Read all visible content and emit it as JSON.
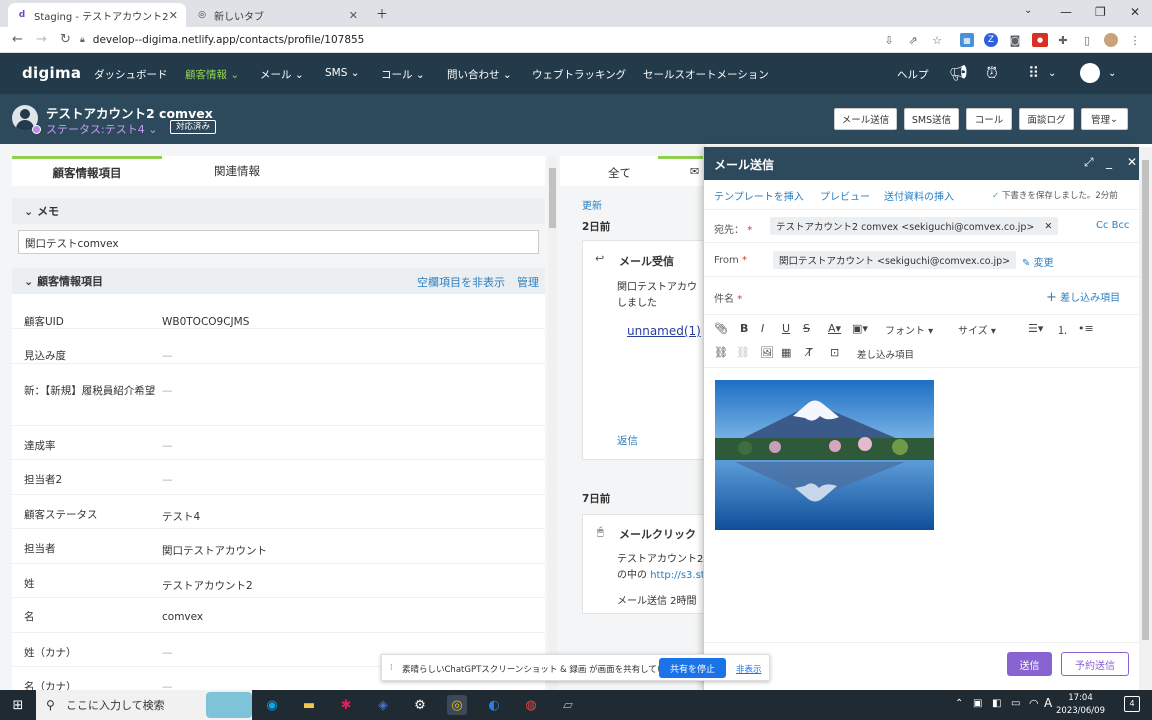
{
  "browser": {
    "tabs": [
      {
        "title": "Staging - テストアカウント2 comvex",
        "active": true
      },
      {
        "title": "新しいタブ",
        "active": false
      }
    ],
    "url": "develop--digima.netlify.app/contacts/profile/107855"
  },
  "app": {
    "logo": "digima",
    "nav": [
      "ダッシュボード",
      "顧客情報",
      "メール",
      "SMS",
      "コール",
      "問い合わせ",
      "ウェブトラッキング",
      "セールスオートメーション"
    ],
    "selected_nav": "顧客情報",
    "help": "ヘルプ"
  },
  "contact": {
    "name": "テストアカウント2 comvex",
    "status": "ステータス:テスト4",
    "badge": "対応済み",
    "actions": [
      "メール送信",
      "SMS送信",
      "コール",
      "面談ログ",
      "管理"
    ]
  },
  "left": {
    "tabs": [
      "顧客情報項目",
      "関連情報"
    ],
    "memo_title": "メモ",
    "memo_value": "関口テストcomvex",
    "info_title": "顧客情報項目",
    "hide_empty": "空欄項目を非表示",
    "manage": "管理",
    "rows": [
      {
        "label": "顧客UID",
        "value": "WB0TOCO9CJMS"
      },
      {
        "label": "見込み度",
        "value": "—"
      },
      {
        "label": "新：【新規】履税員紹介希望",
        "value": "—"
      },
      {
        "label": "達成率",
        "value": "—"
      },
      {
        "label": "担当者2",
        "value": "—"
      },
      {
        "label": "顧客ステータス",
        "value": "テスト4"
      },
      {
        "label": "担当者",
        "value": "関口テストアカウント"
      },
      {
        "label": "姓",
        "value": "テストアカウント2"
      },
      {
        "label": "名",
        "value": "comvex"
      },
      {
        "label": "姓（カナ）",
        "value": "—"
      },
      {
        "label": "名（カナ）",
        "value": "—"
      }
    ]
  },
  "timeline": {
    "tab_all": "全て",
    "update": "更新",
    "group1": "2日前",
    "card1_title": "メール受信",
    "card1_text1": "関口テストアカウ",
    "card1_text2": "しました",
    "card1_link": "unnamed(1)",
    "card1_reply": "返信",
    "group2": "7日前",
    "card2_title": "メールクリック",
    "card2_text1": "テストアカウント2",
    "card2_text2": "の中の",
    "card2_link": "http://s3.sta",
    "card2_footer": "メール送信 2時間"
  },
  "email": {
    "title": "メール送信",
    "insert_template": "テンプレートを挿入",
    "preview": "プレビュー",
    "attach": "送付資料の挿入",
    "saved": "下書きを保存しました。2分前",
    "to_label": "宛先：",
    "to_value": "テストアカウント2 comvex <sekiguchi@comvex.co.jp>",
    "cc_bcc": "Cc Bcc",
    "from_label": "From",
    "from_value": "関口テストアカウント <sekiguchi@comvex.co.jp>",
    "change": "変更",
    "subject_label": "件名",
    "merge_field": "差し込み項目",
    "font": "フォント",
    "size": "サイズ",
    "merge_field2": "差し込み項目",
    "send": "送信",
    "schedule": "予約送信"
  },
  "share_banner": {
    "text": "素晴らしいChatGPTスクリーンショット & 録画 が画面を共有しています。",
    "stop": "共有を停止",
    "hide": "非表示"
  },
  "taskbar": {
    "search": "ここに入力して検索",
    "time": "17:04",
    "date": "2023/06/09",
    "ime": "A",
    "notifications": "4"
  },
  "colors": {
    "nav_bg": "#233a4b",
    "header_bg": "#2d4a5d",
    "accent_green": "#8fd14f",
    "accent_purple": "#8a63d2",
    "link_blue": "#2a7fc1"
  }
}
